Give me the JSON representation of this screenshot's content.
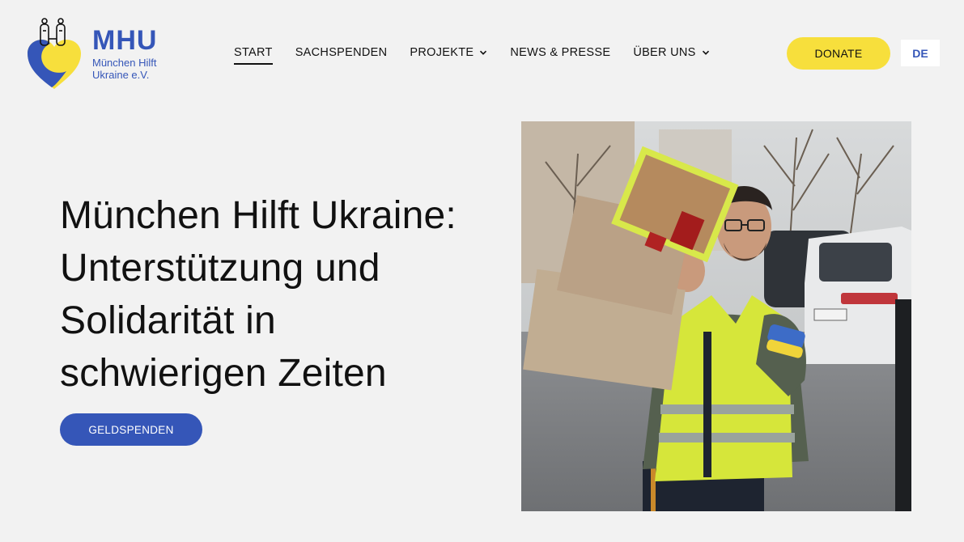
{
  "brand": {
    "short": "MHU",
    "sub_line1": "München Hilft",
    "sub_line2": "Ukraine e.V.",
    "colors": {
      "blue": "#3556b8",
      "yellow": "#f7df3c"
    }
  },
  "nav": {
    "items": [
      {
        "label": "START",
        "active": true,
        "dropdown": false
      },
      {
        "label": "SACHSPENDEN",
        "active": false,
        "dropdown": false
      },
      {
        "label": "PROJEKTE",
        "active": false,
        "dropdown": true
      },
      {
        "label": "NEWS & PRESSE",
        "active": false,
        "dropdown": false
      },
      {
        "label": "ÜBER UNS",
        "active": false,
        "dropdown": true
      }
    ]
  },
  "header": {
    "donate_label": "DONATE",
    "language": "DE"
  },
  "hero": {
    "title_lines": [
      "München Hilft Ukraine:",
      "Unterstützung und",
      "Solidarität in",
      "schwierigen Zeiten"
    ],
    "cta_label": "GELDSPENDEN",
    "image_icon": "volunteer-carrying-boxes-photo"
  }
}
